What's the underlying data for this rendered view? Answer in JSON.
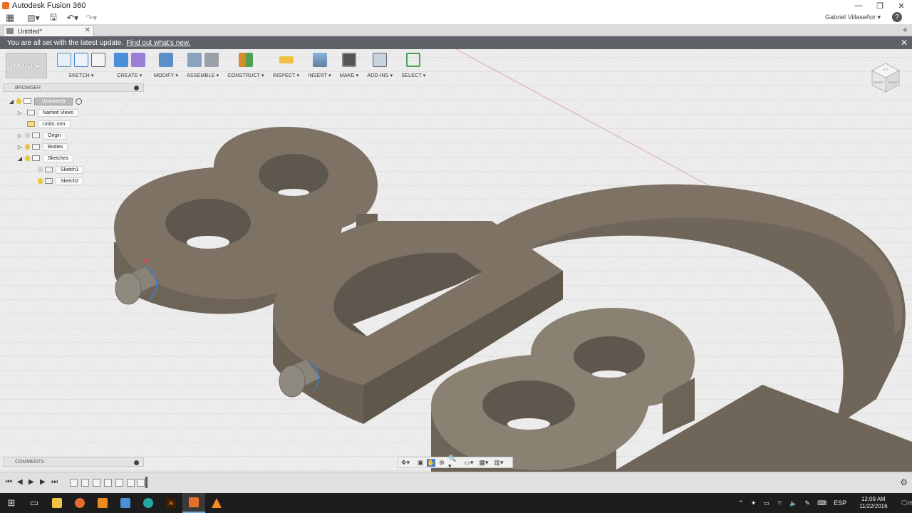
{
  "window": {
    "title": "Autodesk Fusion 360"
  },
  "qat": {
    "user": "Gabriel Villaseñor ▾",
    "help": "?"
  },
  "tab": {
    "name": "Untitled*",
    "close": "✕"
  },
  "notification": {
    "text": "You are all set with the latest update.",
    "link": "Find out what's new.",
    "close": "✕"
  },
  "toolbar": {
    "mode": "MODEL ▾",
    "groups": [
      "SKETCH ▾",
      "CREATE ▾",
      "MODIFY ▾",
      "ASSEMBLE ▾",
      "CONSTRUCT ▾",
      "INSPECT ▾",
      "INSERT ▾",
      "MAKE ▾",
      "ADD-INS ▾",
      "SELECT ▾"
    ]
  },
  "browser": {
    "title": "BROWSER",
    "root": "(Unsaved)",
    "items": [
      "Named Views",
      "Units: mm",
      "Origin",
      "Bodies",
      "Sketches",
      "Sketch1",
      "Sketch2"
    ]
  },
  "comments": {
    "title": "COMMENTS"
  },
  "viewcube": {
    "front": "FRONT",
    "right": "RIGHT",
    "top": "TOP"
  },
  "taskbar": {
    "lang": "ESP",
    "time": "12:09 AM",
    "date": "11/22/2016",
    "notifications": "22"
  },
  "colors": {
    "body": "#7d7264",
    "body_side": "#6a6154",
    "accent": "#3b7fd1",
    "notify_bar": "#5e6166"
  }
}
